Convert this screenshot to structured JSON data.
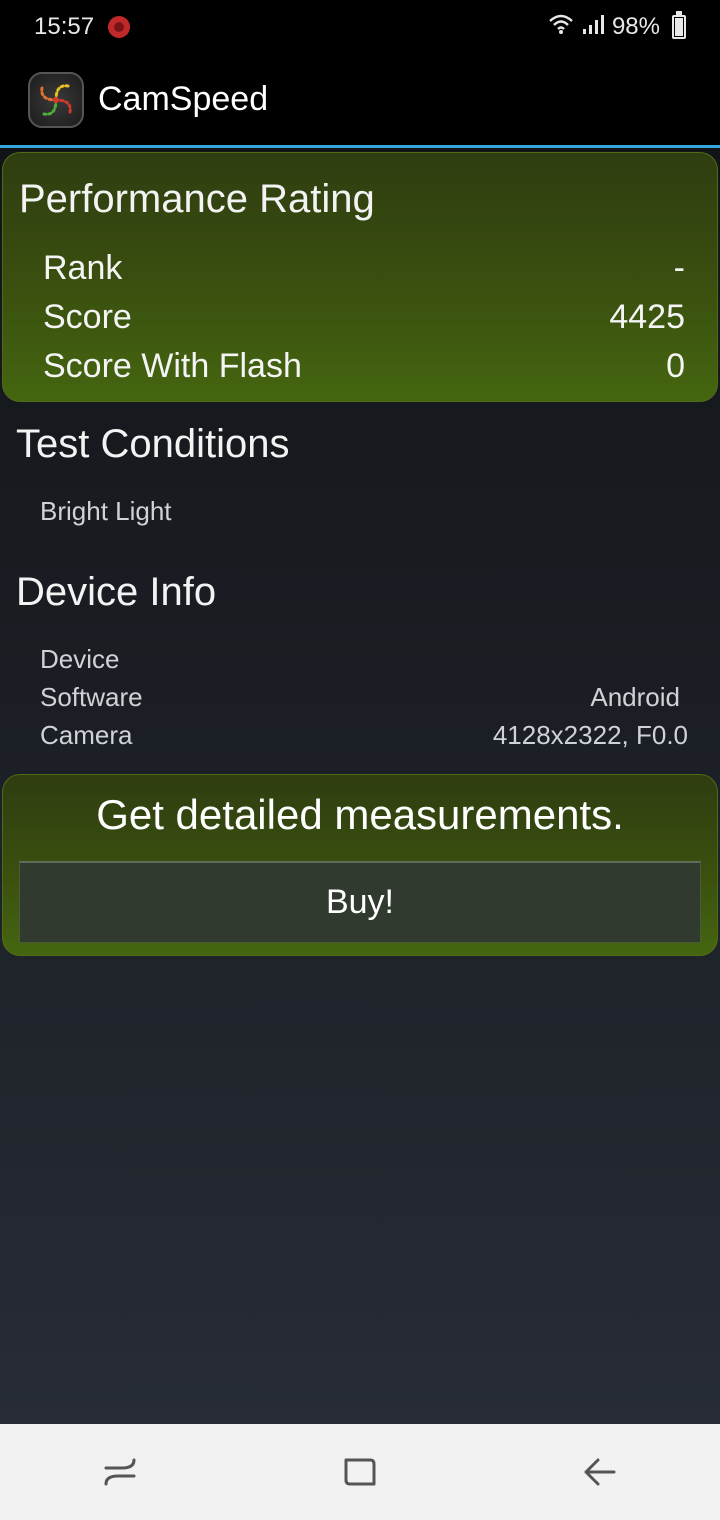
{
  "status_bar": {
    "time": "15:57",
    "notification_icon": "notification-icon",
    "signal_icons": [
      "wifi-icon",
      "cell-signal-icon"
    ],
    "battery": "98%"
  },
  "app_bar": {
    "title": "CamSpeed",
    "icon": "camspeed-logo-icon"
  },
  "performance": {
    "title": "Performance Rating",
    "rows": [
      {
        "label": "Rank",
        "value": "-"
      },
      {
        "label": "Score",
        "value": "4425"
      },
      {
        "label": "Score With Flash",
        "value": "0"
      }
    ]
  },
  "test_conditions": {
    "title": "Test Conditions",
    "value": "Bright Light"
  },
  "device_info": {
    "title": "Device Info",
    "rows": [
      {
        "label": "Device",
        "value": ""
      },
      {
        "label": "Software",
        "value": "Android"
      },
      {
        "label": "Camera",
        "value": "4128x2322, F0.0"
      }
    ]
  },
  "promo": {
    "heading": "Get detailed measurements.",
    "button_label": "Buy!"
  },
  "nav_bar": {
    "items": [
      "recents-icon",
      "home-icon",
      "back-icon"
    ]
  },
  "colors": {
    "accent_line": "#33a6da",
    "card_green": "#3a500f"
  }
}
